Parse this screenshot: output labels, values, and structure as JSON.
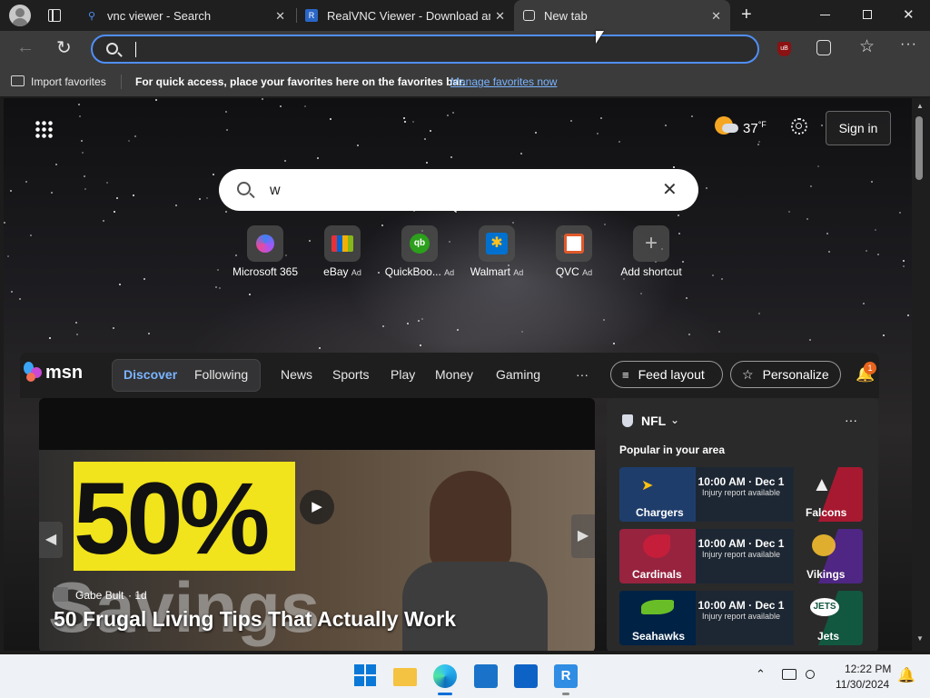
{
  "tabs": [
    {
      "title": "vnc viewer - Search",
      "icon": "bing-search-icon"
    },
    {
      "title": "RealVNC Viewer - Download and",
      "icon": "realvnc-icon"
    },
    {
      "title": "New tab",
      "icon": "new-tab-icon"
    }
  ],
  "address_bar": {
    "value": "",
    "placeholder": ""
  },
  "favorites_bar": {
    "import_label": "Import favorites",
    "message": "For quick access, place your favorites here on the favorites bar.",
    "manage_link": "Manage favorites now"
  },
  "newtab": {
    "weather_temp": "37",
    "weather_unit": "°F",
    "sign_in_label": "Sign in",
    "search_value": "w",
    "shortcuts": [
      {
        "label": "Microsoft 365",
        "ad": ""
      },
      {
        "label": "eBay",
        "ad": "Ad"
      },
      {
        "label": "QuickBoo...",
        "ad": "Ad"
      },
      {
        "label": "Walmart",
        "ad": "Ad"
      },
      {
        "label": "QVC",
        "ad": "Ad"
      },
      {
        "label": "Add shortcut",
        "ad": ""
      }
    ]
  },
  "msn": {
    "logo_text": "msn",
    "tabs": [
      "Discover",
      "Following"
    ],
    "nav": [
      "News",
      "Sports",
      "Play",
      "Money",
      "Gaming"
    ],
    "more_label": "···",
    "feed_layout_label": "Feed layout",
    "personalize_label": "Personalize",
    "notification_count": "1",
    "hero": {
      "author": "Gabe Bult",
      "age": "1d",
      "headline": "50 Frugal Living Tips That Actually Work",
      "image_text": "50%",
      "image_text2": "Savings"
    },
    "nfl": {
      "title": "NFL",
      "subtitle": "Popular in your area",
      "games": [
        {
          "home": "Chargers",
          "away": "Falcons",
          "time": "10:00 AM · Dec 1",
          "note": "Injury report available",
          "home_color": "#1f3d6b",
          "away_color": "#a71930"
        },
        {
          "home": "Cardinals",
          "away": "Vikings",
          "time": "10:00 AM · Dec 1",
          "note": "Injury report available",
          "home_color": "#97233f",
          "away_color": "#4f2683"
        },
        {
          "home": "Seahawks",
          "away": "Jets",
          "time": "10:00 AM · Dec 1",
          "note": "Injury report available",
          "home_color": "#002244",
          "away_color": "#125740"
        }
      ]
    }
  },
  "taskbar": {
    "time": "12:22 PM",
    "date": "11/30/2024"
  },
  "colors": {
    "accent": "#4f8ff7",
    "link": "#7ab4ff",
    "notification": "#e8641c"
  }
}
